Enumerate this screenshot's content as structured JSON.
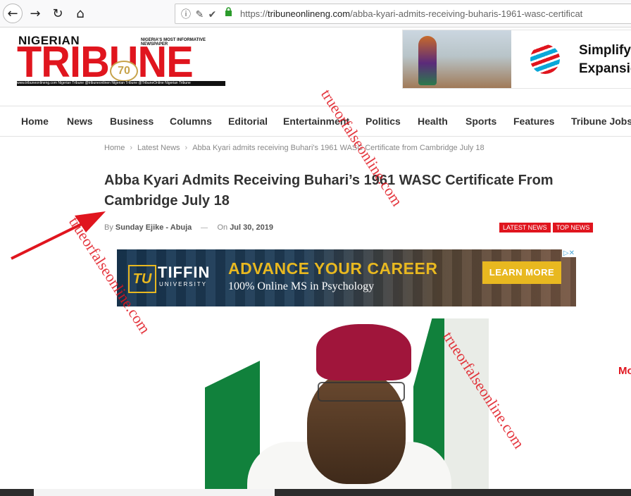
{
  "browser": {
    "back_icon": "←",
    "forward_icon": "→",
    "reload_icon": "↻",
    "home_icon": "⌂",
    "url_icons": "ⓘ ✎ ✔",
    "lock_icon": "🔒",
    "url_scheme": "https://",
    "url_host": "tribuneonlineng.com",
    "url_path": "/abba-kyari-admits-receiving-buharis-1961-wasc-certificat"
  },
  "logo": {
    "small": "NIGERIAN",
    "tagline": "NIGERIA'S MOST INFORMATIVE NEWSPAPER",
    "main": "TRIBUNE",
    "anniversary": "70",
    "footer": "www.tribuneonlineng.com   Nigerian Tribune   @tribuneonlinen   Nigerian Tribune   @TribuneOnline   Nigerian Tribune"
  },
  "top_ad": {
    "line1": "Simplify",
    "line2": "Expansic"
  },
  "nav": [
    "Home",
    "News",
    "Business",
    "Columns",
    "Editorial",
    "Entertainment",
    "Politics",
    "Health",
    "Sports",
    "Features",
    "Tribune Jobs"
  ],
  "breadcrumbs": [
    "Home",
    "Latest News",
    "Abba Kyari admits receiving Buhari's 1961 WASC Certificate from Cambridge July 18"
  ],
  "article": {
    "title": "Abba Kyari Admits Receiving Buhari’s 1961 WASC Certificate From Cambridge July 18",
    "by_label": "By",
    "author": "Sunday Ejike - Abuja",
    "on_label": "On",
    "date": "Jul 30, 2019",
    "tags": [
      "LATEST NEWS",
      "TOP NEWS"
    ]
  },
  "mid_ad": {
    "logo_mark": "TU",
    "brand": "TIFFIN",
    "brand_sub": "UNIVERSITY",
    "headline": "ADVANCE YOUR CAREER",
    "subline": "100% Online MS in Psychology",
    "cta": "LEARN MORE",
    "adchoices": "▷✕"
  },
  "sidebar_fragment": "Mo",
  "watermark": "trueorfalseonline.com",
  "colors": {
    "brand_red": "#e0151e",
    "nav_text": "#333333",
    "ad_gold": "#e8b820"
  }
}
